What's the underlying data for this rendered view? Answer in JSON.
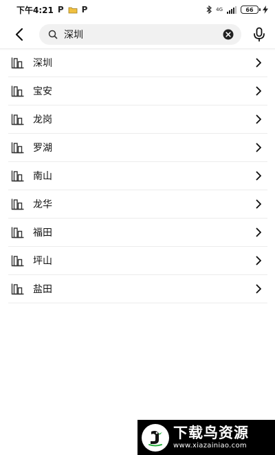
{
  "status_bar": {
    "time": "下午4:21",
    "left_glyph_1": "P",
    "left_glyph_3": "P",
    "network": "4G",
    "battery": "66"
  },
  "search": {
    "query": "深圳",
    "placeholder": ""
  },
  "results": [
    {
      "label": "深圳"
    },
    {
      "label": "宝安"
    },
    {
      "label": "龙岗"
    },
    {
      "label": "罗湖"
    },
    {
      "label": "南山"
    },
    {
      "label": "龙华"
    },
    {
      "label": "福田"
    },
    {
      "label": "坪山"
    },
    {
      "label": "盐田"
    }
  ],
  "watermark": {
    "title": "下载鸟资源",
    "url": "www.xiazainiao.com"
  },
  "colors": {
    "text_primary": "#111111",
    "search_bg": "#f1f1f1",
    "divider": "#ececec",
    "watermark_bg": "#000000",
    "accent_green": "#2fb344"
  },
  "icons": {
    "back": "arrow-left-icon",
    "search": "search-icon",
    "clear": "clear-circle-icon",
    "voice": "microphone-icon",
    "result": "building-icon",
    "chevron": "chevron-right-icon"
  }
}
